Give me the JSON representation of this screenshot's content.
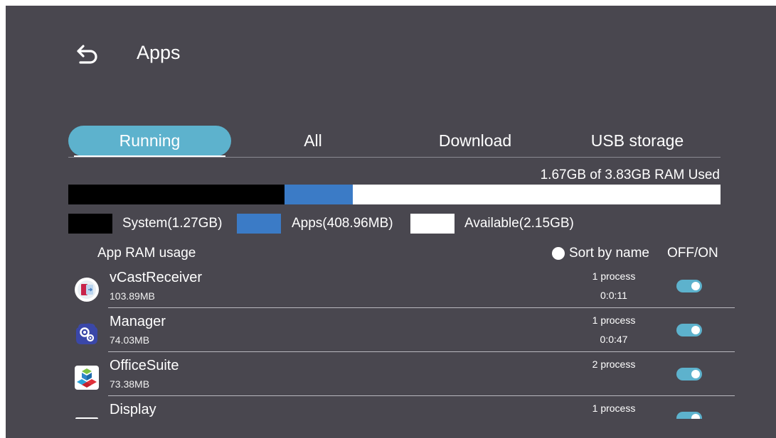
{
  "header": {
    "title": "Apps",
    "back_icon": "back-arrow-icon"
  },
  "tabs": [
    {
      "label": "Running",
      "active": true
    },
    {
      "label": "All",
      "active": false
    },
    {
      "label": "Download",
      "active": false
    },
    {
      "label": "USB storage",
      "active": false
    }
  ],
  "ram": {
    "summary": "1.67GB of 3.83GB RAM Used",
    "system_fraction": 0.332,
    "apps_fraction": 0.104,
    "legend": {
      "system": "System(1.27GB)",
      "apps": "Apps(408.96MB)",
      "available": "Available(2.15GB)"
    },
    "colors": {
      "system": "#000000",
      "apps": "#3b7bc6",
      "available": "#ffffff"
    }
  },
  "list_header": {
    "title": "App RAM usage",
    "sort_label": "Sort by name",
    "toggle_header": "OFF/ON"
  },
  "apps": [
    {
      "name": "vCastReceiver",
      "size": "103.89MB",
      "processes": "1 process",
      "time": "0:0:11",
      "enabled": true,
      "icon": "vcastreceiver-icon"
    },
    {
      "name": "Manager",
      "size": "74.03MB",
      "processes": "1 process",
      "time": "0:0:47",
      "enabled": true,
      "icon": "manager-gears-icon"
    },
    {
      "name": "OfficeSuite",
      "size": "73.38MB",
      "processes": "2 process",
      "time": "",
      "enabled": true,
      "icon": "officesuite-icon"
    },
    {
      "name": "Display",
      "size": "",
      "processes": "1 process",
      "time": "",
      "enabled": true,
      "icon": "display-icon"
    }
  ],
  "colors": {
    "background": "#49474f",
    "accent": "#5db2cd",
    "text": "#ffffff"
  }
}
